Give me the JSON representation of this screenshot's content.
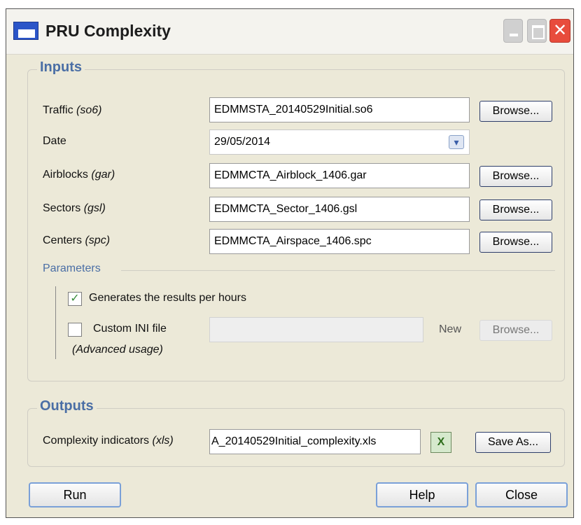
{
  "window": {
    "title": "PRU Complexity",
    "close_glyph": "✕"
  },
  "inputs": {
    "group_title": "Inputs",
    "traffic": {
      "label": "Traffic ",
      "hint": "(so6)",
      "value": "EDMMSTA_20140529Initial.so6",
      "browse": "Browse..."
    },
    "date": {
      "label": "Date",
      "value": "29/05/2014",
      "arrow": "▾"
    },
    "airblocks": {
      "label": "Airblocks ",
      "hint": "(gar)",
      "value": "EDMMCTA_Airblock_1406.gar",
      "browse": "Browse..."
    },
    "sectors": {
      "label": "Sectors ",
      "hint": "(gsl)",
      "value": "EDMMCTA_Sector_1406.gsl",
      "browse": "Browse..."
    },
    "centers": {
      "label": "Centers ",
      "hint": "(spc)",
      "value": "EDMMCTA_Airspace_1406.spc",
      "browse": "Browse..."
    }
  },
  "parameters": {
    "title": "Parameters",
    "per_hours": {
      "label": "Generates the results per hours",
      "checked": true,
      "check_glyph": "✓"
    },
    "custom_ini": {
      "label": "Custom INI file",
      "sublabel": "(Advanced usage)",
      "checked": false,
      "value": "",
      "new": "New",
      "browse": "Browse..."
    }
  },
  "outputs": {
    "group_title": "Outputs",
    "complexity": {
      "label": "Complexity indicators ",
      "hint": "(xls)",
      "value": "A_20140529Initial_complexity.xls",
      "excel_glyph": "X",
      "save_as": "Save As..."
    }
  },
  "footer": {
    "run": "Run",
    "help": "Help",
    "close": "Close"
  }
}
